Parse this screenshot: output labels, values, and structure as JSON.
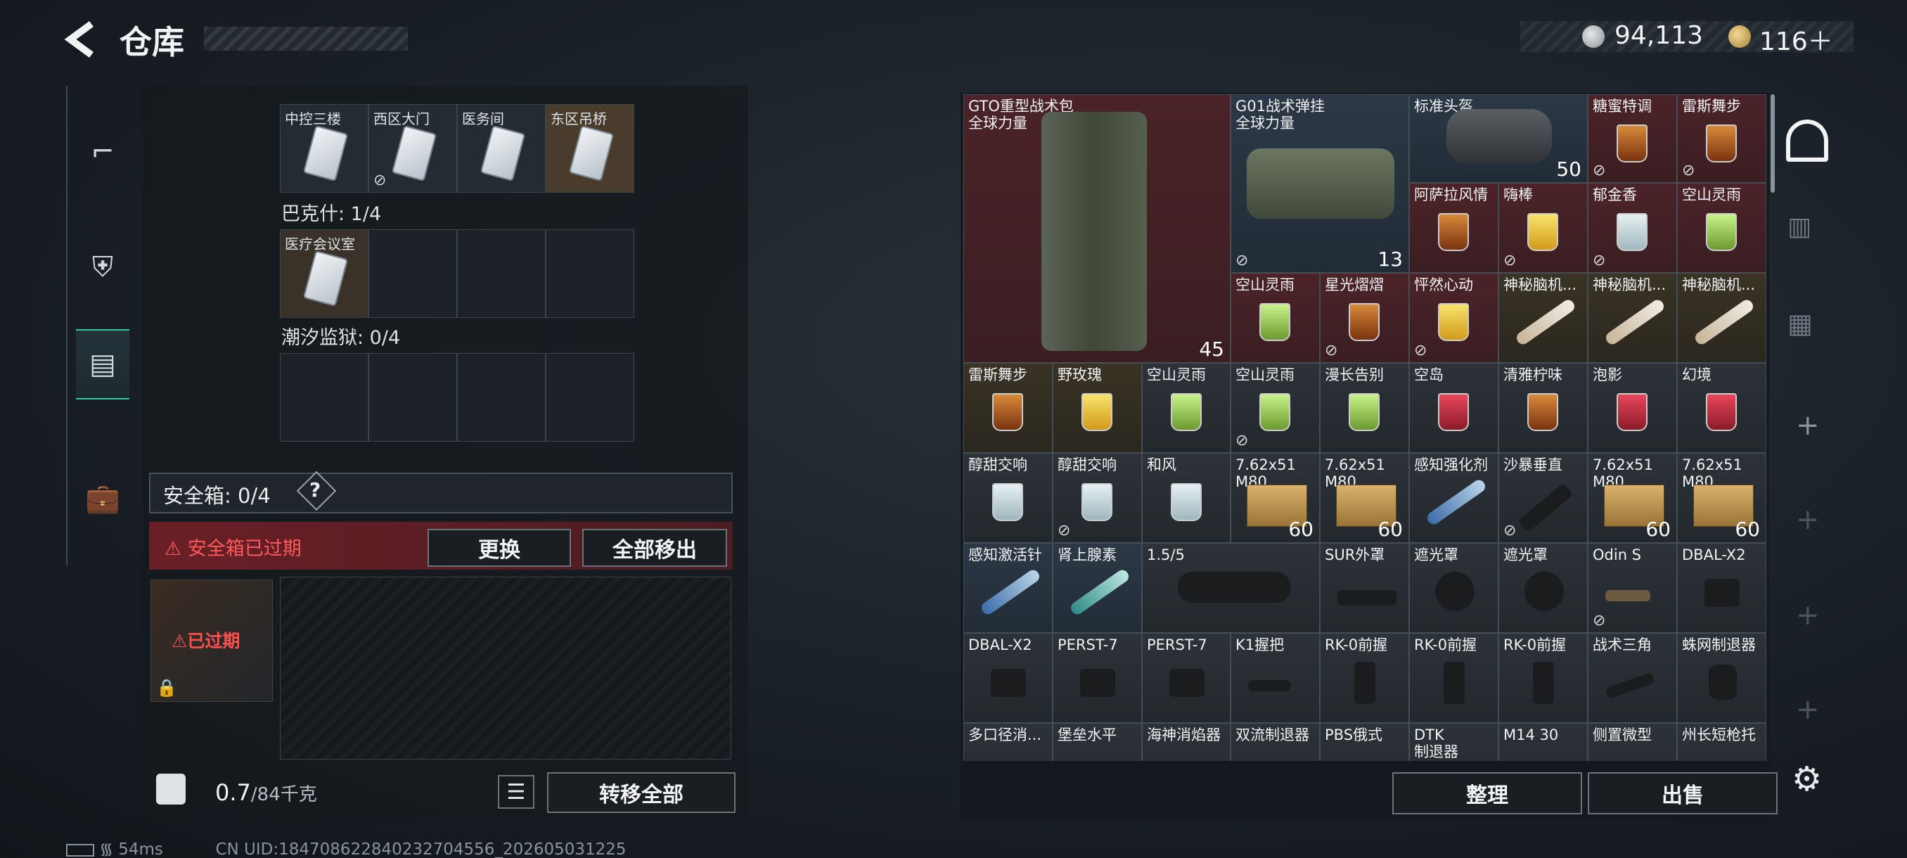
{
  "header": {
    "title": "仓库",
    "money": "94,113",
    "premium": "116＋"
  },
  "keycards": {
    "row1": [
      "中控三楼",
      "西区大门",
      "医务间",
      "东区吊桥"
    ],
    "bakeshi_label": "巴克什: 1/4",
    "row2": [
      "医疗会议室"
    ],
    "chaoxi_label": "潮汐监狱: 0/4"
  },
  "safe": {
    "label": "安全箱: 0/4",
    "help": "?",
    "expired_banner": "安全箱已过期",
    "replace_btn": "更换",
    "move_all_btn": "全部移出",
    "box_badge": "已过期"
  },
  "weight": {
    "value": "0.7",
    "cap": "/84千克",
    "transfer_btn": "转移全部"
  },
  "storage": {
    "items": [
      {
        "t": "GTO重型战术包\n全球力量",
        "cnt": "45"
      },
      {
        "t": "G01战术弹挂\n全球力量",
        "cnt": "13"
      },
      {
        "t": "标准头盔",
        "cnt": "50"
      },
      {
        "t": "糖蜜特调"
      },
      {
        "t": "雷斯舞步"
      },
      {
        "t": "阿萨拉风情"
      },
      {
        "t": "嗨棒"
      },
      {
        "t": "郁金香"
      },
      {
        "t": "空山灵雨"
      },
      {
        "t": "空山灵雨"
      },
      {
        "t": "星光熠熠"
      },
      {
        "t": "怦然心动"
      },
      {
        "t": "神秘脑机..."
      },
      {
        "t": "神秘脑机..."
      },
      {
        "t": "神秘脑机..."
      },
      {
        "t": "雷斯舞步"
      },
      {
        "t": "野玫瑰"
      },
      {
        "t": "空山灵雨"
      },
      {
        "t": "空山灵雨"
      },
      {
        "t": "漫长告别"
      },
      {
        "t": "空岛"
      },
      {
        "t": "清雅柠味"
      },
      {
        "t": "泡影"
      },
      {
        "t": "幻境"
      },
      {
        "t": "醇甜交响"
      },
      {
        "t": "醇甜交响"
      },
      {
        "t": "和风"
      },
      {
        "t": "7.62x51\nM80",
        "cnt": "60"
      },
      {
        "t": "7.62x51\nM80",
        "cnt": "60"
      },
      {
        "t": "感知强化剂"
      },
      {
        "t": "沙暴垂直"
      },
      {
        "t": "7.62x51\nM80",
        "cnt": "60"
      },
      {
        "t": "7.62x51\nM80",
        "cnt": "60"
      },
      {
        "t": "感知激活针"
      },
      {
        "t": "肾上腺素"
      },
      {
        "t": "1.5/5"
      },
      {
        "t": "SUR外罩"
      },
      {
        "t": "遮光罩"
      },
      {
        "t": "遮光罩"
      },
      {
        "t": "Odin S"
      },
      {
        "t": "DBAL-X2"
      },
      {
        "t": "DBAL-X2"
      },
      {
        "t": "PERST-7"
      },
      {
        "t": "PERST-7"
      },
      {
        "t": "K1握把"
      },
      {
        "t": "RK-0前握"
      },
      {
        "t": "RK-0前握"
      },
      {
        "t": "RK-0前握"
      },
      {
        "t": "战术三角"
      },
      {
        "t": "蛛网制退器"
      },
      {
        "t": "多口径消..."
      },
      {
        "t": "堡垒水平"
      },
      {
        "t": "海神消焰器"
      },
      {
        "t": "双流制退器"
      },
      {
        "t": "PBS俄式"
      },
      {
        "t": "DTK\n制退器"
      },
      {
        "t": "M14 30"
      },
      {
        "t": "侧置微型"
      },
      {
        "t": "州长短枪托"
      }
    ],
    "sort_btn": "整理",
    "sell_btn": "出售"
  },
  "status": {
    "ping": "54ms",
    "uid": "CN UID:184708622840232704556_202605031225"
  }
}
